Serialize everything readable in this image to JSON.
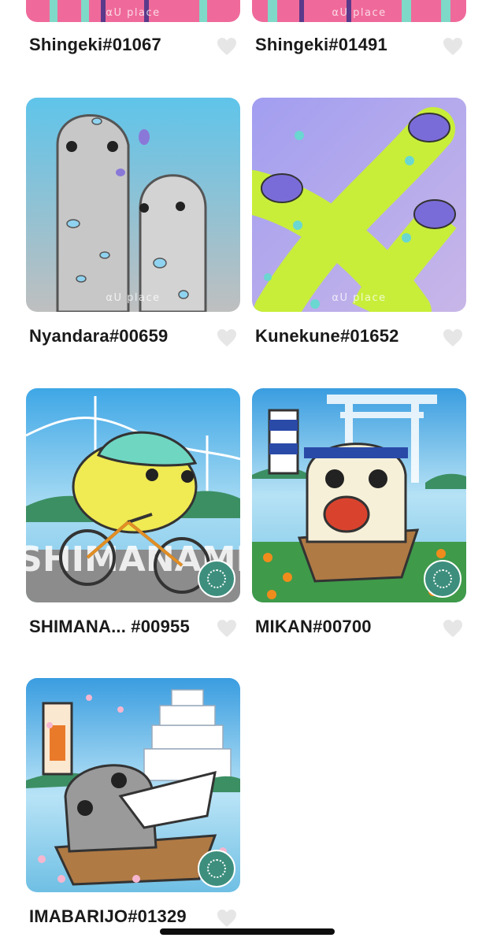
{
  "items": [
    {
      "title": "Shingeki#01067",
      "watermark": "αU place"
    },
    {
      "title": "Shingeki#01491",
      "watermark": "αU place"
    },
    {
      "title": "Nyandara#00659",
      "watermark": "αU place"
    },
    {
      "title": "Kunekune#01652",
      "watermark": "αU place"
    },
    {
      "title": "SHIMANA... #00955",
      "art_text": "SHIMANAMI"
    },
    {
      "title": "MIKAN#00700"
    },
    {
      "title": "IMABARIJO#01329"
    }
  ],
  "colors": {
    "heart": "#e6e6e6",
    "title": "#1a1a1a"
  }
}
